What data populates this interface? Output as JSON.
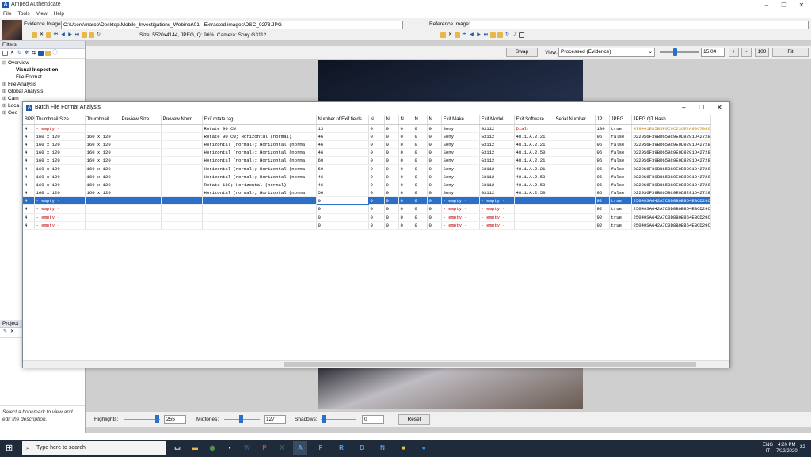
{
  "app": {
    "title": "Amped Authenticate",
    "icon": "amped-logo-icon"
  },
  "menu": [
    "File",
    "Tools",
    "View",
    "Help"
  ],
  "evidence": {
    "label": "Evidence Image:",
    "path": "C:\\Users\\marco\\Desktop\\Mobile_Investigations_Webinar\\01 - Extracted images\\DSC_0273.JPG",
    "info": "Size: 5520x4144, JPEG, Q: 96%, Camera: Sony G3112"
  },
  "reference": {
    "label": "Reference Image:",
    "path": ""
  },
  "filters": {
    "title": "Filters",
    "items": [
      {
        "label": "Overview",
        "indent": 0,
        "prefix": "⊟"
      },
      {
        "label": "Visual Inspection",
        "indent": 2,
        "prefix": "",
        "bold": true
      },
      {
        "label": "File Format",
        "indent": 2,
        "prefix": ""
      },
      {
        "label": "File Analysis",
        "indent": 0,
        "prefix": "⊞"
      },
      {
        "label": "Global Analysis",
        "indent": 0,
        "prefix": "⊞"
      },
      {
        "label": "Cam",
        "indent": 0,
        "prefix": "⊞"
      },
      {
        "label": "Loca",
        "indent": 0,
        "prefix": "⊞"
      },
      {
        "label": "Geo",
        "indent": 0,
        "prefix": "⊞"
      }
    ]
  },
  "project": {
    "title": "Project",
    "hint": "Select a bookmark to view and edit the description."
  },
  "viewbar": {
    "swap": "Swap",
    "view_label": "View:",
    "view_value": "Processed (Evidence)",
    "zoom": "15.04",
    "plus": "+",
    "minus": "-",
    "hundred": "100",
    "fit": "Fit"
  },
  "bottom": {
    "highlights_label": "Highlights:",
    "highlights": "255",
    "midtones_label": "Midtones:",
    "midtones": "127",
    "shadows_label": "Shadows:",
    "shadows": "0",
    "reset": "Reset"
  },
  "dialog": {
    "title": "Batch File Format Analysis",
    "columns": [
      "BPP",
      "Thumbnail Size",
      "Thumbnail ...",
      "Preview Size",
      "Preview Norm...",
      "Exif rotate tag",
      "Number of Exif fields",
      "N...",
      "N...",
      "N...",
      "N...",
      "N...",
      "Exif Make",
      "Exif Model",
      "Exif Software",
      "Serial Number",
      "JP...",
      "JPEG ...",
      "JPEG QT Hash"
    ],
    "rows": [
      [
        "4",
        "- empty -",
        "",
        "",
        "",
        "Rotate 90 CW",
        "13",
        "0",
        "0",
        "0",
        "0",
        "0",
        "Sony",
        "G3112",
        "Dialr",
        "",
        "100",
        "true",
        "B79441E85B5F9C9C236E2A9067086ED"
      ],
      [
        "4",
        "160 x 120",
        "160 x 120",
        "",
        "",
        "Rotate 90 CW; Horizontal (normal)",
        "46",
        "0",
        "0",
        "0",
        "0",
        "0",
        "Sony",
        "G3112",
        "48.1.A.2.21",
        "",
        "96",
        "false",
        "D229S6F39BD65BC9E0D8291D427281D"
      ],
      [
        "4",
        "160 x 120",
        "160 x 120",
        "",
        "",
        "Horizontal (normal); Horizontal (norma",
        "46",
        "0",
        "0",
        "0",
        "0",
        "0",
        "Sony",
        "G3112",
        "48.1.A.2.21",
        "",
        "96",
        "false",
        "D229S6F39BD65BC9E0D8291D427281D"
      ],
      [
        "4",
        "160 x 120",
        "160 x 120",
        "",
        "",
        "Horizontal (normal); Horizontal (norma",
        "46",
        "0",
        "0",
        "0",
        "0",
        "0",
        "Sony",
        "G3112",
        "48.1.A.2.50",
        "",
        "96",
        "false",
        "D229S6F39BD65BC9E0D8291D427281D"
      ],
      [
        "4",
        "160 x 120",
        "160 x 120",
        "",
        "",
        "Horizontal (normal); Horizontal (norma",
        "60",
        "0",
        "0",
        "0",
        "0",
        "0",
        "Sony",
        "G3112",
        "48.1.A.2.21",
        "",
        "96",
        "false",
        "D229S6F39BD65BC9E0D8291D427281D"
      ],
      [
        "4",
        "160 x 120",
        "160 x 120",
        "",
        "",
        "Horizontal (normal); Horizontal (norma",
        "60",
        "0",
        "0",
        "0",
        "0",
        "0",
        "Sony",
        "G3112",
        "48.1.A.2.21",
        "",
        "96",
        "false",
        "D229S6F39BD65BC9E0D8291D427281D"
      ],
      [
        "4",
        "160 x 120",
        "160 x 120",
        "",
        "",
        "Horizontal (normal); Horizontal (norma",
        "46",
        "0",
        "0",
        "0",
        "0",
        "0",
        "Sony",
        "G3112",
        "48.1.A.2.50",
        "",
        "96",
        "false",
        "D229S6F39BD65BC9E0D8291D427281D"
      ],
      [
        "4",
        "160 x 120",
        "160 x 120",
        "",
        "",
        "Rotate 180; Horizontal (normal)",
        "46",
        "0",
        "0",
        "0",
        "0",
        "0",
        "Sony",
        "G3112",
        "48.1.A.2.50",
        "",
        "96",
        "false",
        "D229S6F39BD65BC9E0D8291D427281D"
      ],
      [
        "4",
        "160 x 120",
        "160 x 120",
        "",
        "",
        "Horizontal (normal); Horizontal (norma",
        "56",
        "0",
        "0",
        "0",
        "0",
        "0",
        "Sony",
        "G3112",
        "48.1.A.2.50",
        "",
        "96",
        "false",
        "D229S6F39BD65BC9E0D8291D427281D"
      ],
      [
        "4",
        "- empty -",
        "",
        "",
        "",
        "",
        "0",
        "0",
        "0",
        "0",
        "0",
        "0",
        "- empty -",
        "- empty -",
        "",
        "",
        "92",
        "true",
        "25049SA642A7C0D8B0B864EBCD29C66"
      ],
      [
        "4",
        "- empty -",
        "",
        "",
        "",
        "",
        "0",
        "0",
        "0",
        "0",
        "0",
        "0",
        "- empty -",
        "- empty -",
        "",
        "",
        "92",
        "true",
        "25049SA642A7C0D8B0B864EBCD29C66"
      ],
      [
        "4",
        "- empty -",
        "",
        "",
        "",
        "",
        "0",
        "0",
        "0",
        "0",
        "0",
        "0",
        "- empty -",
        "- empty -",
        "",
        "",
        "92",
        "true",
        "25049SA642A7C0D8B0B864EBCD29C66"
      ],
      [
        "4",
        "- empty -",
        "",
        "",
        "",
        "",
        "0",
        "0",
        "0",
        "0",
        "0",
        "0",
        "- empty -",
        "- empty -",
        "",
        "",
        "92",
        "true",
        "25049SA642A7C0D8B0B864EBCD29C66"
      ]
    ],
    "selected_row": 9
  },
  "taskbar": {
    "search": "Type here to search",
    "time": "4:20 PM",
    "date": "7/22/2020",
    "lang": "ENG",
    "region": "IT",
    "notif": "22"
  },
  "colors": {
    "accent": "#2c6fc9",
    "empty": "#c00000",
    "hash_first": "#d08000"
  }
}
